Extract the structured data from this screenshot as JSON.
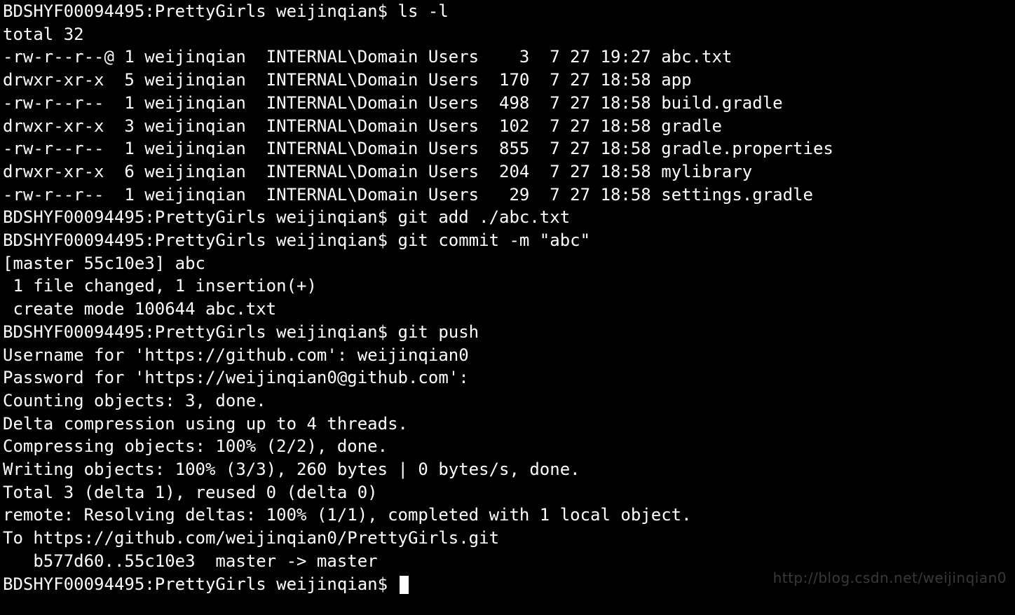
{
  "prompt": "BDSHYF00094495:PrettyGirls weijinqian$ ",
  "lines": [
    "BDSHYF00094495:PrettyGirls weijinqian$ ls -l",
    "total 32",
    "-rw-r--r--@ 1 weijinqian  INTERNAL\\Domain Users    3  7 27 19:27 abc.txt",
    "drwxr-xr-x  5 weijinqian  INTERNAL\\Domain Users  170  7 27 18:58 app",
    "-rw-r--r--  1 weijinqian  INTERNAL\\Domain Users  498  7 27 18:58 build.gradle",
    "drwxr-xr-x  3 weijinqian  INTERNAL\\Domain Users  102  7 27 18:58 gradle",
    "-rw-r--r--  1 weijinqian  INTERNAL\\Domain Users  855  7 27 18:58 gradle.properties",
    "drwxr-xr-x  6 weijinqian  INTERNAL\\Domain Users  204  7 27 18:58 mylibrary",
    "-rw-r--r--  1 weijinqian  INTERNAL\\Domain Users   29  7 27 18:58 settings.gradle",
    "BDSHYF00094495:PrettyGirls weijinqian$ git add ./abc.txt",
    "BDSHYF00094495:PrettyGirls weijinqian$ git commit -m \"abc\"",
    "[master 55c10e3] abc",
    " 1 file changed, 1 insertion(+)",
    " create mode 100644 abc.txt",
    "BDSHYF00094495:PrettyGirls weijinqian$ git push",
    "Username for 'https://github.com': weijinqian0",
    "Password for 'https://weijinqian0@github.com': ",
    "Counting objects: 3, done.",
    "Delta compression using up to 4 threads.",
    "Compressing objects: 100% (2/2), done.",
    "Writing objects: 100% (3/3), 260 bytes | 0 bytes/s, done.",
    "Total 3 (delta 1), reused 0 (delta 0)",
    "remote: Resolving deltas: 100% (1/1), completed with 1 local object.",
    "To https://github.com/weijinqian0/PrettyGirls.git",
    "   b577d60..55c10e3  master -> master"
  ],
  "watermark": "http://blog.csdn.net/weijinqian0"
}
